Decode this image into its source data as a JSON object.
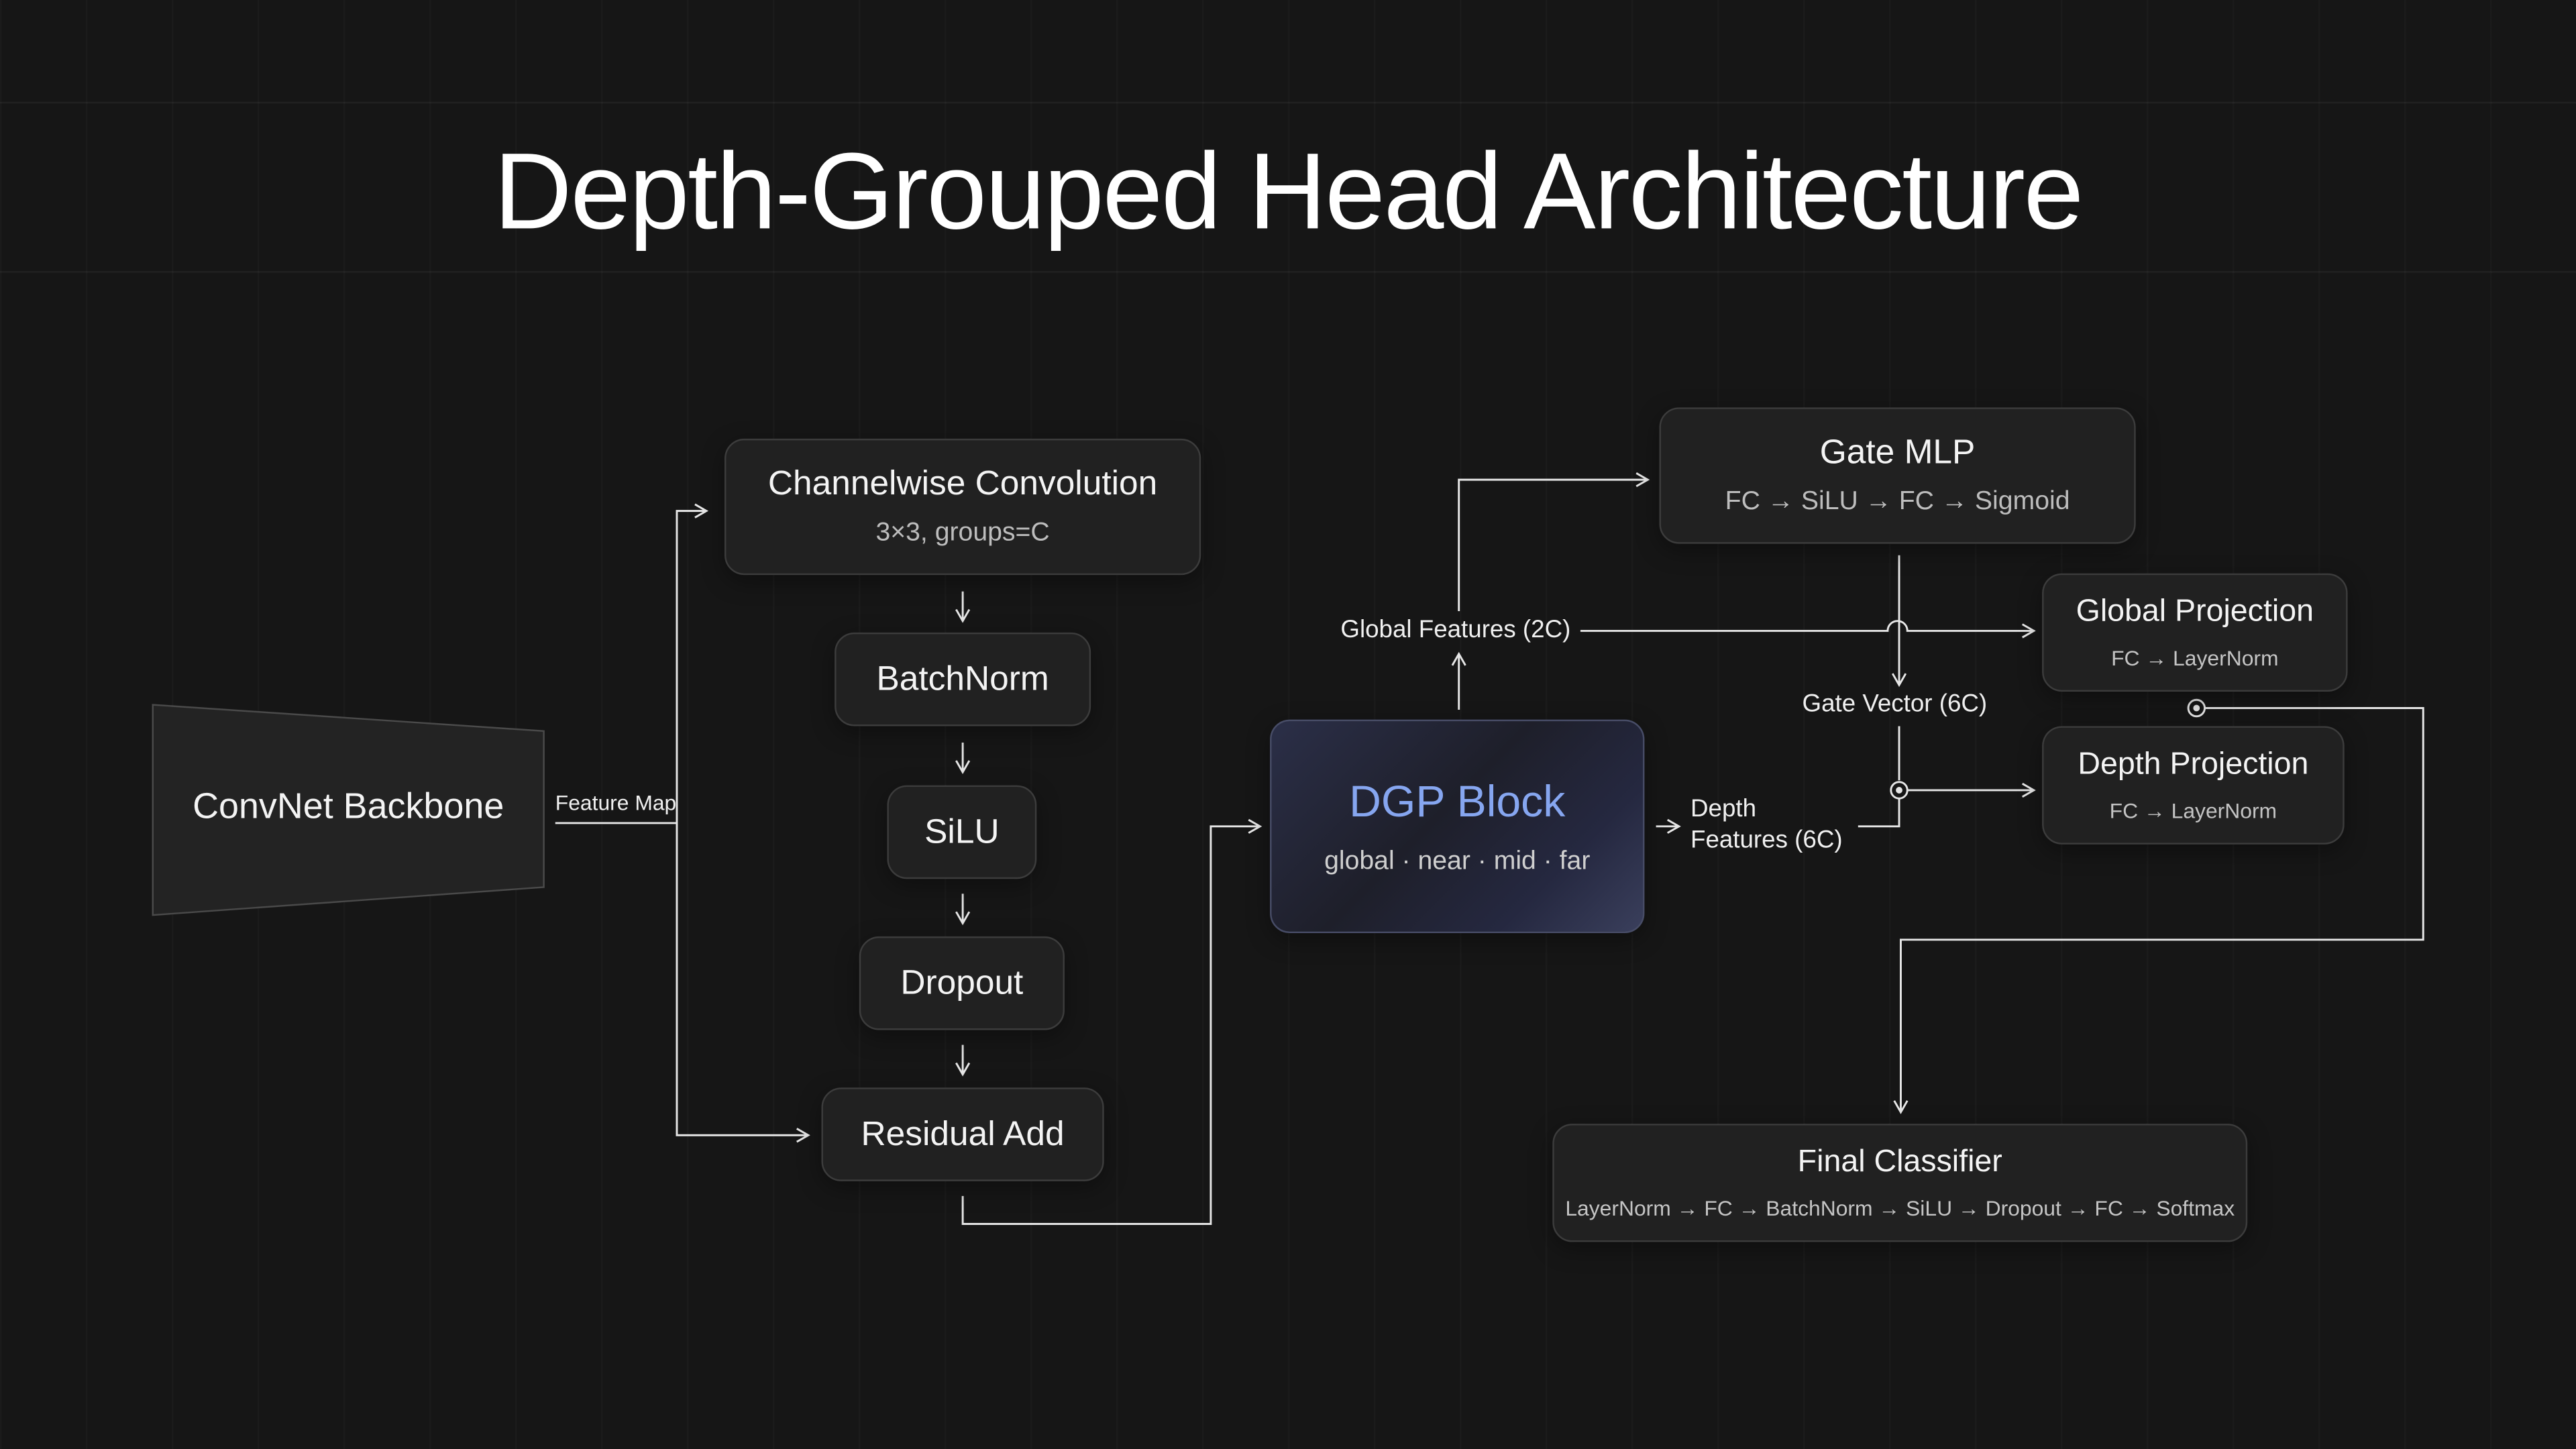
{
  "title": "Depth-Grouped Head Architecture",
  "backbone": {
    "label": "ConvNet Backbone",
    "edge_label": "Feature Map"
  },
  "nodes": {
    "channelwise_conv": {
      "title": "Channelwise Convolution",
      "sub": "3×3, groups=C"
    },
    "batchnorm": {
      "title": "BatchNorm"
    },
    "silu": {
      "title": "SiLU"
    },
    "dropout": {
      "title": "Dropout"
    },
    "residual_add": {
      "title": "Residual Add"
    },
    "dgp_block": {
      "title": "DGP Block",
      "sub": "global · near · mid · far"
    },
    "gate_mlp": {
      "title": "Gate MLP",
      "sub": "FC → SiLU → FC → Sigmoid"
    },
    "global_projection": {
      "title": "Global Projection",
      "sub": "FC → LayerNorm"
    },
    "depth_projection": {
      "title": "Depth Projection",
      "sub": "FC → LayerNorm"
    },
    "final_classifier": {
      "title": "Final Classifier",
      "sub": "LayerNorm → FC → BatchNorm → SiLU → Dropout → FC → Softmax"
    }
  },
  "edge_labels": {
    "global_features": "Global Features (2C)",
    "depth_features_line1": "Depth",
    "depth_features_line2": "Features (6C)",
    "gate_vector": "Gate Vector (6C)"
  },
  "colors": {
    "background": "#161616",
    "box_fill": "#212121",
    "box_border": "#3c3c3c",
    "accent_text": "#86a6f0",
    "wire": "#e6e6e6"
  }
}
